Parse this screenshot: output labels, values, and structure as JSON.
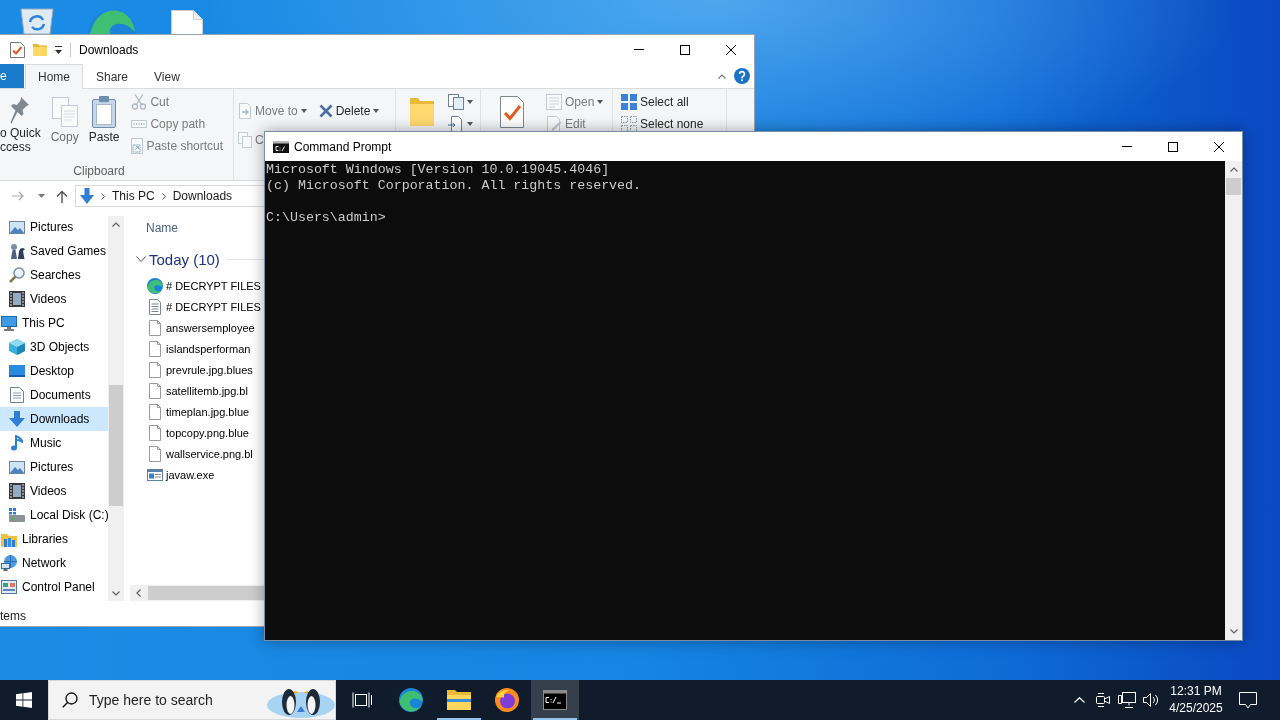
{
  "explorer": {
    "title": "Downloads",
    "tabs": [
      {
        "kind": "file",
        "label": "e",
        "selected": false
      },
      {
        "kind": "tab",
        "label": "Home",
        "selected": true
      },
      {
        "kind": "tab",
        "label": "Share",
        "selected": false
      },
      {
        "kind": "tab",
        "label": "View",
        "selected": false
      }
    ],
    "ribbon": [
      {
        "label": "Clipboard",
        "commands": [
          {
            "kind": "pin",
            "lines": [
              "o Quick",
              "ccess"
            ],
            "disabled": false
          },
          {
            "kind": "copy",
            "lines": [
              "Copy"
            ],
            "disabled": true
          },
          {
            "kind": "paste",
            "lines": [
              "Paste"
            ],
            "disabled": false
          },
          {
            "kind": "cut",
            "lines": [
              "Cut"
            ],
            "disabled": true
          },
          {
            "kind": "copy-path",
            "lines": [
              "Copy path"
            ],
            "disabled": true
          },
          {
            "kind": "paste-shortcut",
            "lines": [
              "Paste shortcut"
            ],
            "disabled": true
          }
        ]
      },
      {
        "commands": [
          {
            "kind": "move-to",
            "lines": [
              "Move to"
            ],
            "disabled": true
          },
          {
            "kind": "delete",
            "lines": [
              "Delete"
            ],
            "disabled": false
          },
          {
            "kind": "copy-to",
            "lines": [
              "C"
            ],
            "disabled": true
          }
        ]
      },
      {
        "commands": [
          {
            "kind": "new-folder",
            "disabled": false
          },
          {
            "kind": "new-item",
            "disabled": false
          },
          {
            "kind": "easy-access",
            "disabled": false
          }
        ]
      },
      {
        "commands": [
          {
            "kind": "properties",
            "disabled": false
          },
          {
            "kind": "open",
            "lines": [
              "Open"
            ],
            "disabled": true
          },
          {
            "kind": "edit",
            "lines": [
              "Edit"
            ],
            "disabled": true
          }
        ]
      },
      {
        "commands": [
          {
            "kind": "select-all",
            "lines": [
              "Select all"
            ],
            "disabled": false
          },
          {
            "kind": "select-none",
            "lines": [
              "Select none"
            ],
            "disabled": false
          }
        ]
      }
    ],
    "address": {
      "crumbs": [
        "This PC",
        "Downloads"
      ]
    },
    "nav_pane": {
      "items": [
        {
          "children": [
            {
              "kind": "pictures",
              "label": "Pictures",
              "selected": false
            },
            {
              "kind": "games",
              "label": "Saved Games",
              "selected": false
            },
            {
              "kind": "search",
              "label": "Searches",
              "selected": false
            },
            {
              "kind": "videos",
              "label": "Videos",
              "selected": false
            }
          ]
        },
        {
          "kind": "pc",
          "label": "This PC",
          "selected": false,
          "children": [
            {
              "kind": "objects",
              "label": "3D Objects",
              "selected": false
            },
            {
              "kind": "desktop",
              "label": "Desktop",
              "selected": false
            },
            {
              "kind": "documents",
              "label": "Documents",
              "selected": false
            },
            {
              "kind": "downloads",
              "label": "Downloads",
              "selected": true
            },
            {
              "kind": "music",
              "label": "Music",
              "selected": false
            },
            {
              "kind": "pictures",
              "label": "Pictures",
              "selected": false
            },
            {
              "kind": "videos",
              "label": "Videos",
              "selected": false
            },
            {
              "kind": "disk",
              "label": "Local Disk (C:)",
              "selected": false
            }
          ]
        },
        {
          "kind": "libraries",
          "label": "Libraries",
          "selected": false
        },
        {
          "kind": "network",
          "label": "Network",
          "selected": false
        },
        {
          "kind": "control-panel",
          "label": "Control Panel",
          "selected": false
        }
      ]
    },
    "file_list": {
      "columns": [
        "Name"
      ],
      "groups": [
        {
          "label": "Today (10)",
          "expanded": true,
          "files": [
            {
              "kind": "web",
              "name": "# DECRYPT FILES"
            },
            {
              "kind": "text",
              "name": "# DECRYPT FILES"
            },
            {
              "kind": "blank",
              "name": "answersemployee"
            },
            {
              "kind": "blank",
              "name": "islandsperforman"
            },
            {
              "kind": "blank",
              "name": "prevrule.jpg.blues"
            },
            {
              "kind": "blank",
              "name": "satellitemb.jpg.bl"
            },
            {
              "kind": "blank",
              "name": "timeplan.jpg.blue"
            },
            {
              "kind": "blank",
              "name": "topcopy.png.blue"
            },
            {
              "kind": "blank",
              "name": "wallservice.png.bl"
            },
            {
              "kind": "app",
              "name": "javaw.exe"
            }
          ]
        }
      ]
    },
    "status_bar": "tems"
  },
  "console": {
    "title": "Command Prompt",
    "output": [
      "Microsoft Windows [Version 10.0.19045.4046]",
      "(c) Microsoft Corporation. All rights reserved."
    ],
    "prompt": "C:\\Users\\admin>"
  },
  "taskbar": {
    "search": {
      "placeholder": "Type here to search"
    },
    "apps": [
      {
        "kind": "browser",
        "running": false,
        "active": false
      },
      {
        "kind": "files",
        "running": true,
        "active": false
      },
      {
        "kind": "fox",
        "running": false,
        "active": false
      },
      {
        "kind": "console",
        "running": true,
        "active": true
      }
    ],
    "clock": {
      "time": "12:31 PM",
      "date": "4/25/2025"
    }
  }
}
